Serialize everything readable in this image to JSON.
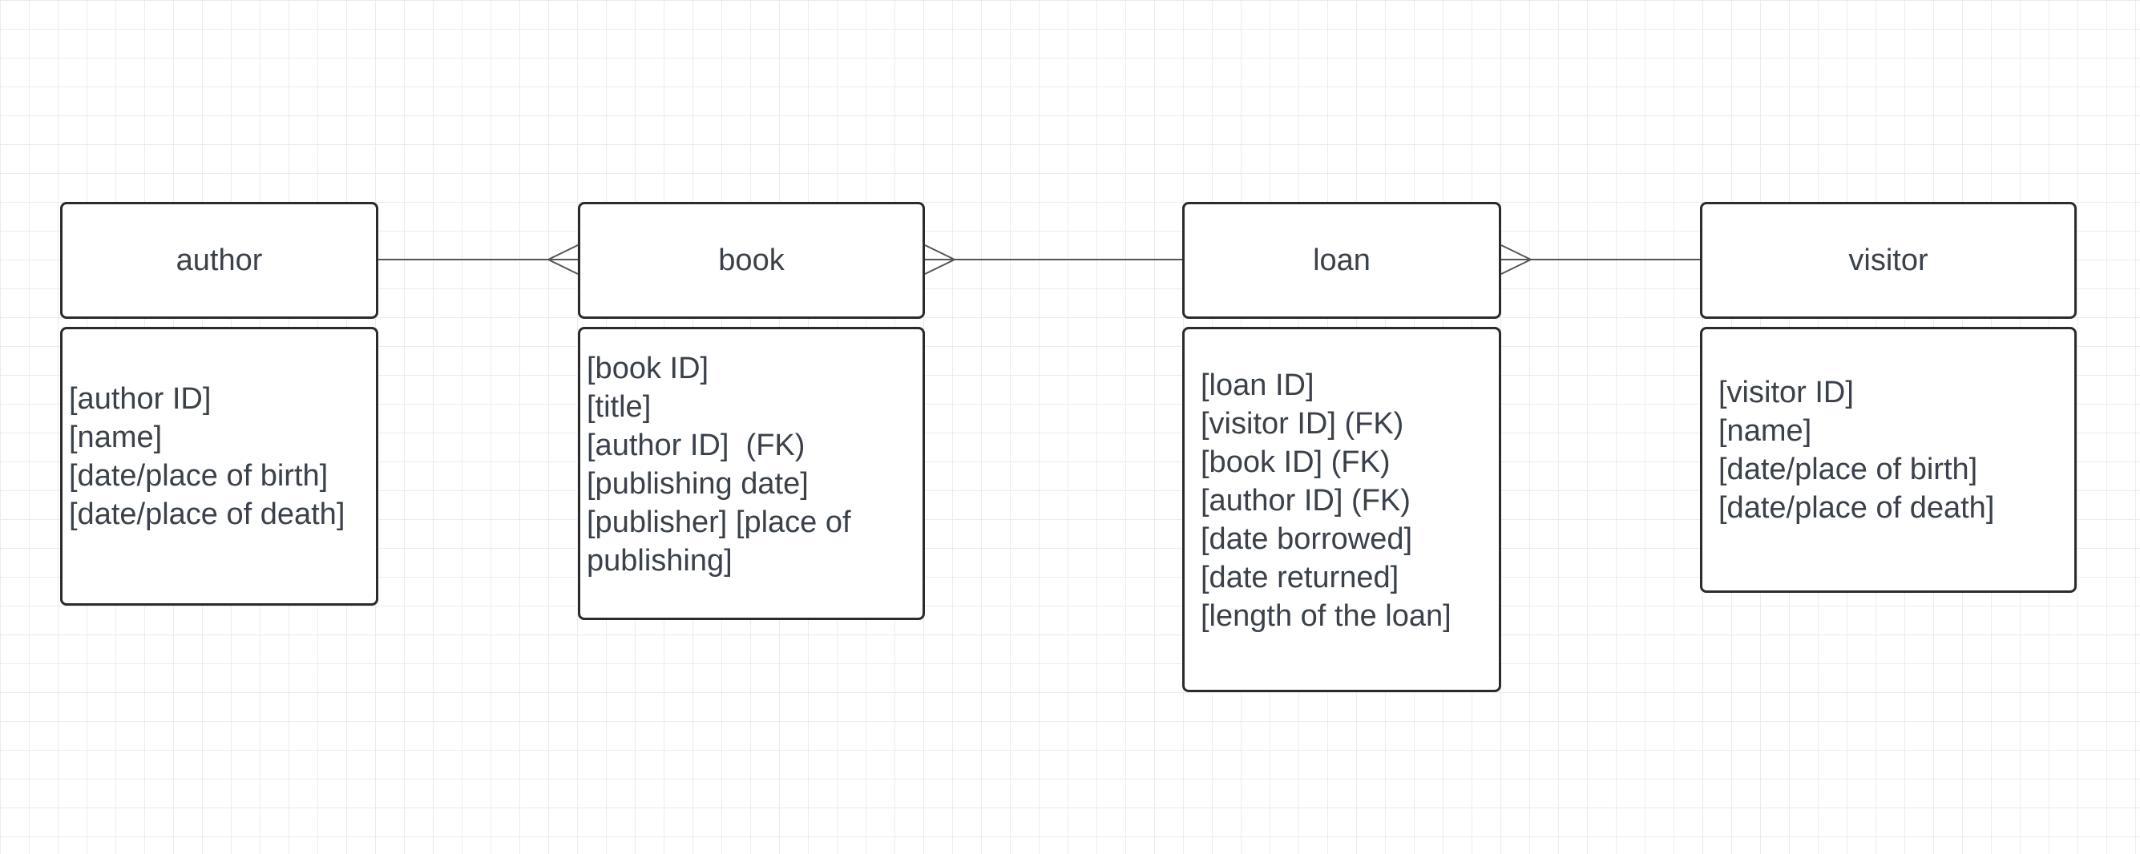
{
  "entities": {
    "author": {
      "title": "author",
      "attributes": [
        "[author ID]",
        "[name]",
        "[date/place of birth]",
        "[date/place of death]"
      ]
    },
    "book": {
      "title": "book",
      "attributes": [
        "[book ID]",
        "[title]",
        "[author ID]  (FK)",
        "[publishing date]",
        "[publisher] [place of",
        "publishing]"
      ]
    },
    "loan": {
      "title": "loan",
      "attributes": [
        "[loan ID]",
        "[visitor ID] (FK)",
        "[book ID] (FK)",
        "[author ID] (FK)",
        "[date borrowed]",
        "[date returned]",
        "[length of the loan]"
      ]
    },
    "visitor": {
      "title": "visitor",
      "attributes": [
        "[visitor ID]",
        "[name]",
        "[date/place of birth]",
        "[date/place of death]"
      ]
    }
  },
  "relationships": [
    {
      "from": "author",
      "to": "book",
      "to_end": "many"
    },
    {
      "from": "loan",
      "to": "book",
      "to_end": "many"
    },
    {
      "from": "visitor",
      "to": "loan",
      "to_end": "many"
    }
  ],
  "colors": {
    "border": "#2b2b2b",
    "text": "#3a414a",
    "grid": "#ececec",
    "connector": "#555555"
  }
}
